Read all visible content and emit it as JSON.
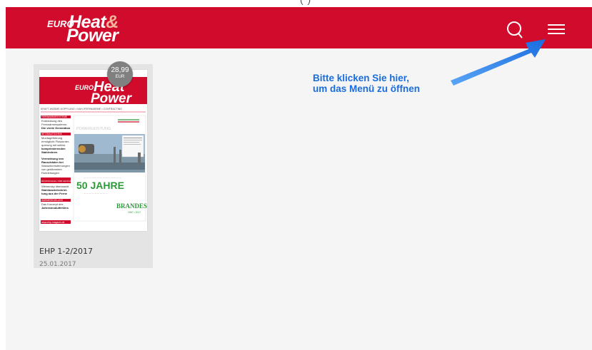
{
  "top_caption": "( )",
  "brand": {
    "euro": "EURO",
    "heat": "Heat",
    "amp": "&",
    "power": "Power"
  },
  "magazine": {
    "price_value": "28,99",
    "price_currency": "EUR",
    "title": "EHP 1-2/2017",
    "date": "25.01.2017",
    "cover": {
      "euro": "EURO",
      "heat": "Heat",
      "power": "Power",
      "tagline": "KRAFT-WÄRME-KOPPLUNG ▪ NAH-/FERNWÄRME ▪ CONTRACTING",
      "headline": "50 JAHRE",
      "brand": "BRANDES",
      "years": "1967 • 2017",
      "subhead": "POWERLEISTUNG",
      "url": "www.ehp-magazin.de",
      "sidebar": [
        {
          "title": "FERNWÄRMESYSTEME",
          "lines": [
            "Entwicklung des",
            "Fernwärmesystems:",
            "Die vierte Generation"
          ]
        },
        {
          "title": "NETZBAUTECHNIK",
          "lines": [
            "Montageführung",
            "ermöglicht Flussunter-",
            "querung mit selbst-",
            "komprimierenden",
            "Stahlrohren"
          ]
        },
        {
          "title": "",
          "lines": [
            "Vermeidung von",
            "Rauschäden bei",
            "Wasserkreisfernungen",
            "von gedämmten",
            "Rohrleitungen"
          ]
        },
        {
          "title": "RÜCKSCHLAG- UND LECKAGESENSORIK",
          "lines": [
            "Weinersky überwacht",
            "Stahlmantelrohrlei-",
            "tung aus der Ferne"
          ]
        },
        {
          "title": "WÄRMEREGELUNG",
          "lines": [
            "Das Konzept des",
            "Jahresmodulfehlers"
          ]
        }
      ]
    }
  },
  "hint": {
    "line1": "Bitte klicken Sie hier,",
    "line2": "um das Menü zu öffnen"
  },
  "colors": {
    "brand_red": "#d10b2b",
    "hint_blue": "#1a6de0",
    "card_bg": "#e4e4e4"
  },
  "icons": {
    "search": "search-icon",
    "menu": "hamburger-menu-icon",
    "arrow": "arrow-pointer-icon"
  }
}
